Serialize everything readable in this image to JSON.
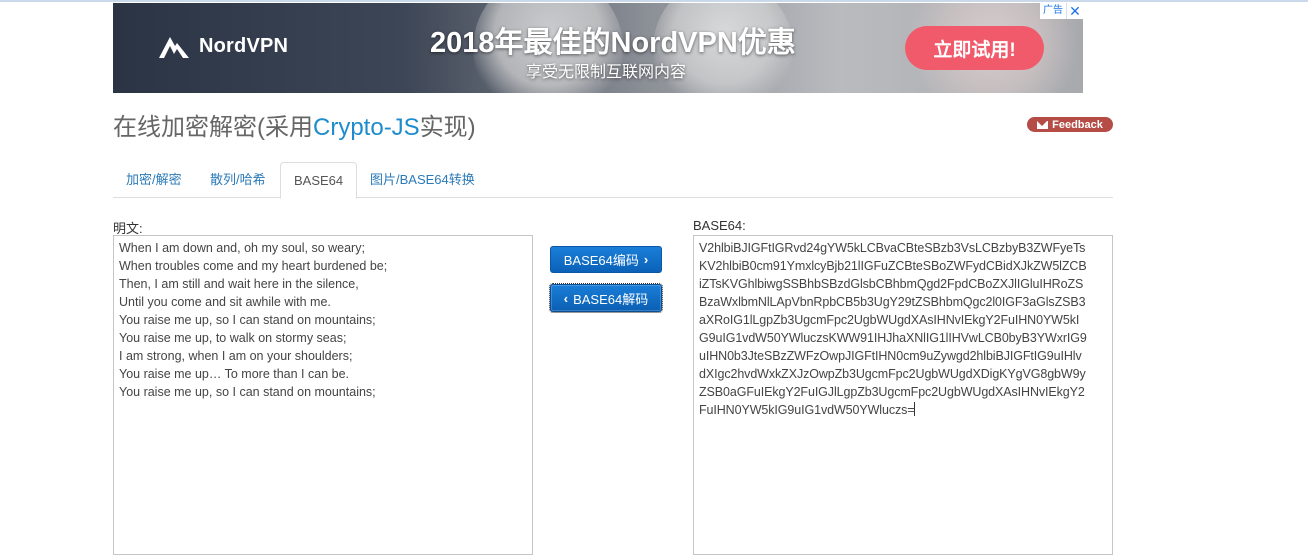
{
  "ad": {
    "brand": "NordVPN",
    "headline": "2018年最佳的NordVPN优惠",
    "subline": "享受无限制互联网内容",
    "cta": "立即试用!",
    "adchoice_label": "广告",
    "adchoice_close": "✕"
  },
  "header": {
    "title_prefix": "在线加密解密(采用",
    "title_accent": "Crypto-JS",
    "title_suffix": "实现)",
    "feedback_label": "Feedback"
  },
  "tabs": [
    {
      "label": "加密/解密",
      "active": false
    },
    {
      "label": "散列/哈希",
      "active": false
    },
    {
      "label": "BASE64",
      "active": true
    },
    {
      "label": "图片/BASE64转换",
      "active": false
    }
  ],
  "plain": {
    "label": "明文:",
    "lines": [
      "When I am down and, oh my soul, so weary;",
      "When troubles come and my heart burdened be;",
      "Then, I am still and wait here in the silence,",
      "Until you come and sit awhile with me.",
      "You raise me up, so I can stand on mountains;",
      "You raise me up, to walk on stormy seas;",
      "I am strong, when I am on your shoulders;",
      "You raise me up… To more than I can be.",
      "You raise me up, so I can stand on mountains;"
    ]
  },
  "buttons": {
    "encode": "BASE64编码",
    "decode": "BASE64解码"
  },
  "encoded": {
    "label": "BASE64:",
    "lines": [
      "V2hlbiBJIGFtIGRvd24gYW5kLCBvaCBteSBzb3VsLCBzbyB3ZWFyeTs",
      "KV2hlbiB0cm91YmxlcyBjb21lIGFuZCBteSBoZWFydCBidXJkZW5lZCB",
      "iZTsKVGhlbiwgSSBhbSBzdGlsbCBhbmQgd2FpdCBoZXJlIGluIHRoZS",
      "BzaWxlbmNlLApVbnRpbCB5b3UgY29tZSBhbmQgc2l0IGF3aGlsZSB3",
      "aXRoIG1lLgpZb3UgcmFpc2UgbWUgdXAsIHNvIEkgY2FuIHN0YW5kI",
      "G9uIG1vdW50YWluczsKWW91IHJhaXNlIG1lIHVwLCB0byB3YWxrIG9",
      "uIHN0b3JteSBzZWFzOwpJIGFtIHN0cm9uZywgd2hlbiBJIGFtIG9uIHlv",
      "dXIgc2hvdWxkZXJzOwpZb3UgcmFpc2UgbWUgdXDigKYgVG8gbW9y",
      "ZSB0aGFuIEkgY2FuIGJlLgpZb3UgcmFpc2UgbWUgdXAsIHNvIEkgY2",
      "FuIHN0YW5kIG9uIG1vdW50YWluczs="
    ]
  }
}
